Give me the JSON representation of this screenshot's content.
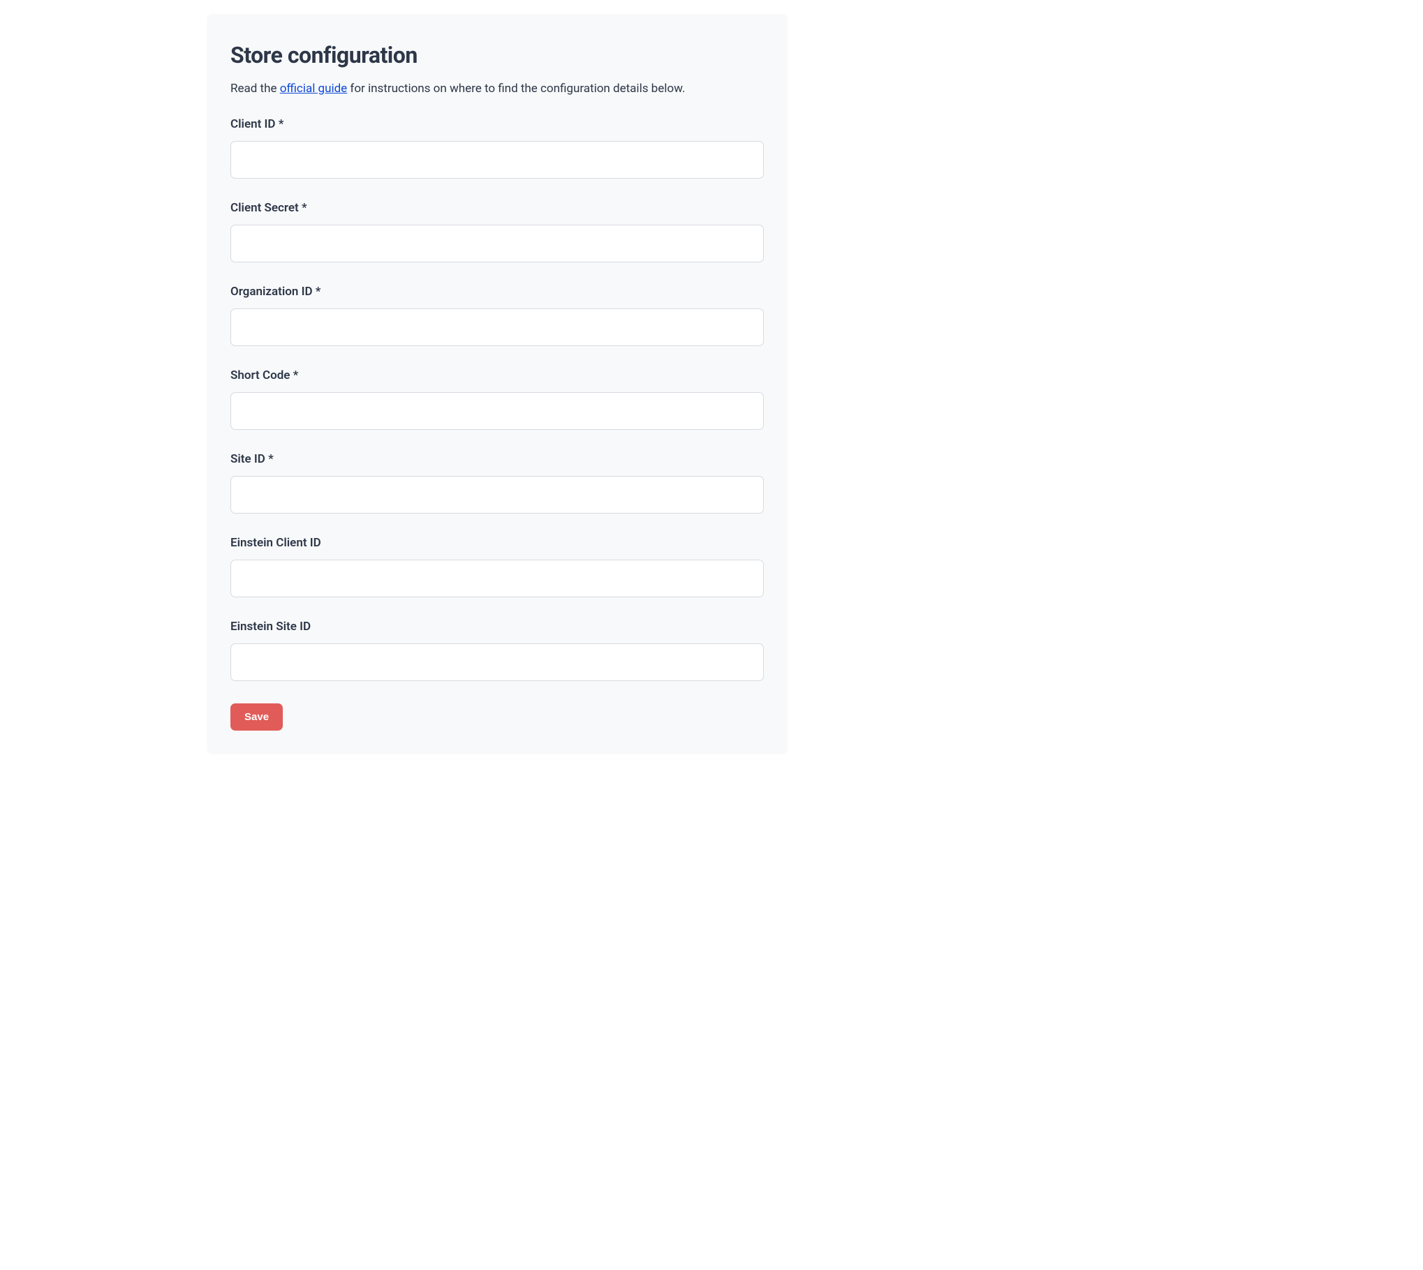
{
  "title": "Store configuration",
  "intro": {
    "before": "Read the ",
    "link_text": "official guide",
    "after": " for instructions on where to find the configuration details below."
  },
  "fields": {
    "client_id": {
      "label": "Client ID *",
      "value": ""
    },
    "client_secret": {
      "label": "Client Secret *",
      "value": ""
    },
    "organization_id": {
      "label": "Organization ID *",
      "value": ""
    },
    "short_code": {
      "label": "Short Code *",
      "value": ""
    },
    "site_id": {
      "label": "Site ID *",
      "value": ""
    },
    "einstein_client_id": {
      "label": "Einstein Client ID",
      "value": ""
    },
    "einstein_site_id": {
      "label": "Einstein Site ID",
      "value": ""
    }
  },
  "buttons": {
    "save": "Save"
  }
}
